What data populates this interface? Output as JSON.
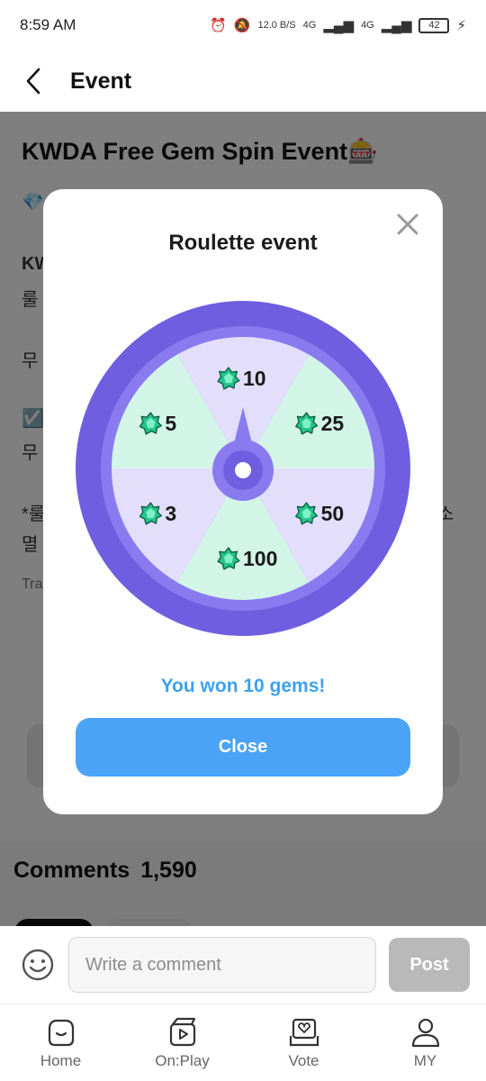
{
  "status_bar": {
    "time": "8:59 AM",
    "net_speed": "12.0 B/S",
    "signal1": "4G",
    "signal2": "4G",
    "battery": "42"
  },
  "header": {
    "title": "Event"
  },
  "background": {
    "event_title": "KWDA Free Gem Spin Event🎰",
    "line1": "💎",
    "line2": "KW",
    "line3": "룰",
    "line4": "무",
    "line5": "☑️",
    "line6": "무",
    "line7": "*룰",
    "line8": "멸",
    "right_fragment": "소",
    "caption": "Tra"
  },
  "modal": {
    "title": "Roulette event",
    "segments": [
      "10",
      "25",
      "50",
      "100",
      "3",
      "5"
    ],
    "result": "You won 10 gems!",
    "close_label": "Close"
  },
  "comments": {
    "title": "Comments",
    "count": "1,590"
  },
  "comment_bar": {
    "placeholder": "Write a comment",
    "post_label": "Post"
  },
  "nav": {
    "items": [
      {
        "label": "Home",
        "icon": "home-icon"
      },
      {
        "label": "On:Play",
        "icon": "onplay-icon"
      },
      {
        "label": "Vote",
        "icon": "vote-icon"
      },
      {
        "label": "MY",
        "icon": "profile-icon"
      }
    ]
  },
  "colors": {
    "wheel_outer": "#6f5ee0",
    "wheel_ring": "#8a7af0",
    "segment_green": "#d3f5e8",
    "segment_purple": "#e3defb",
    "accent_blue": "#4aa3f7",
    "gem_green": "#3ee0a5"
  }
}
